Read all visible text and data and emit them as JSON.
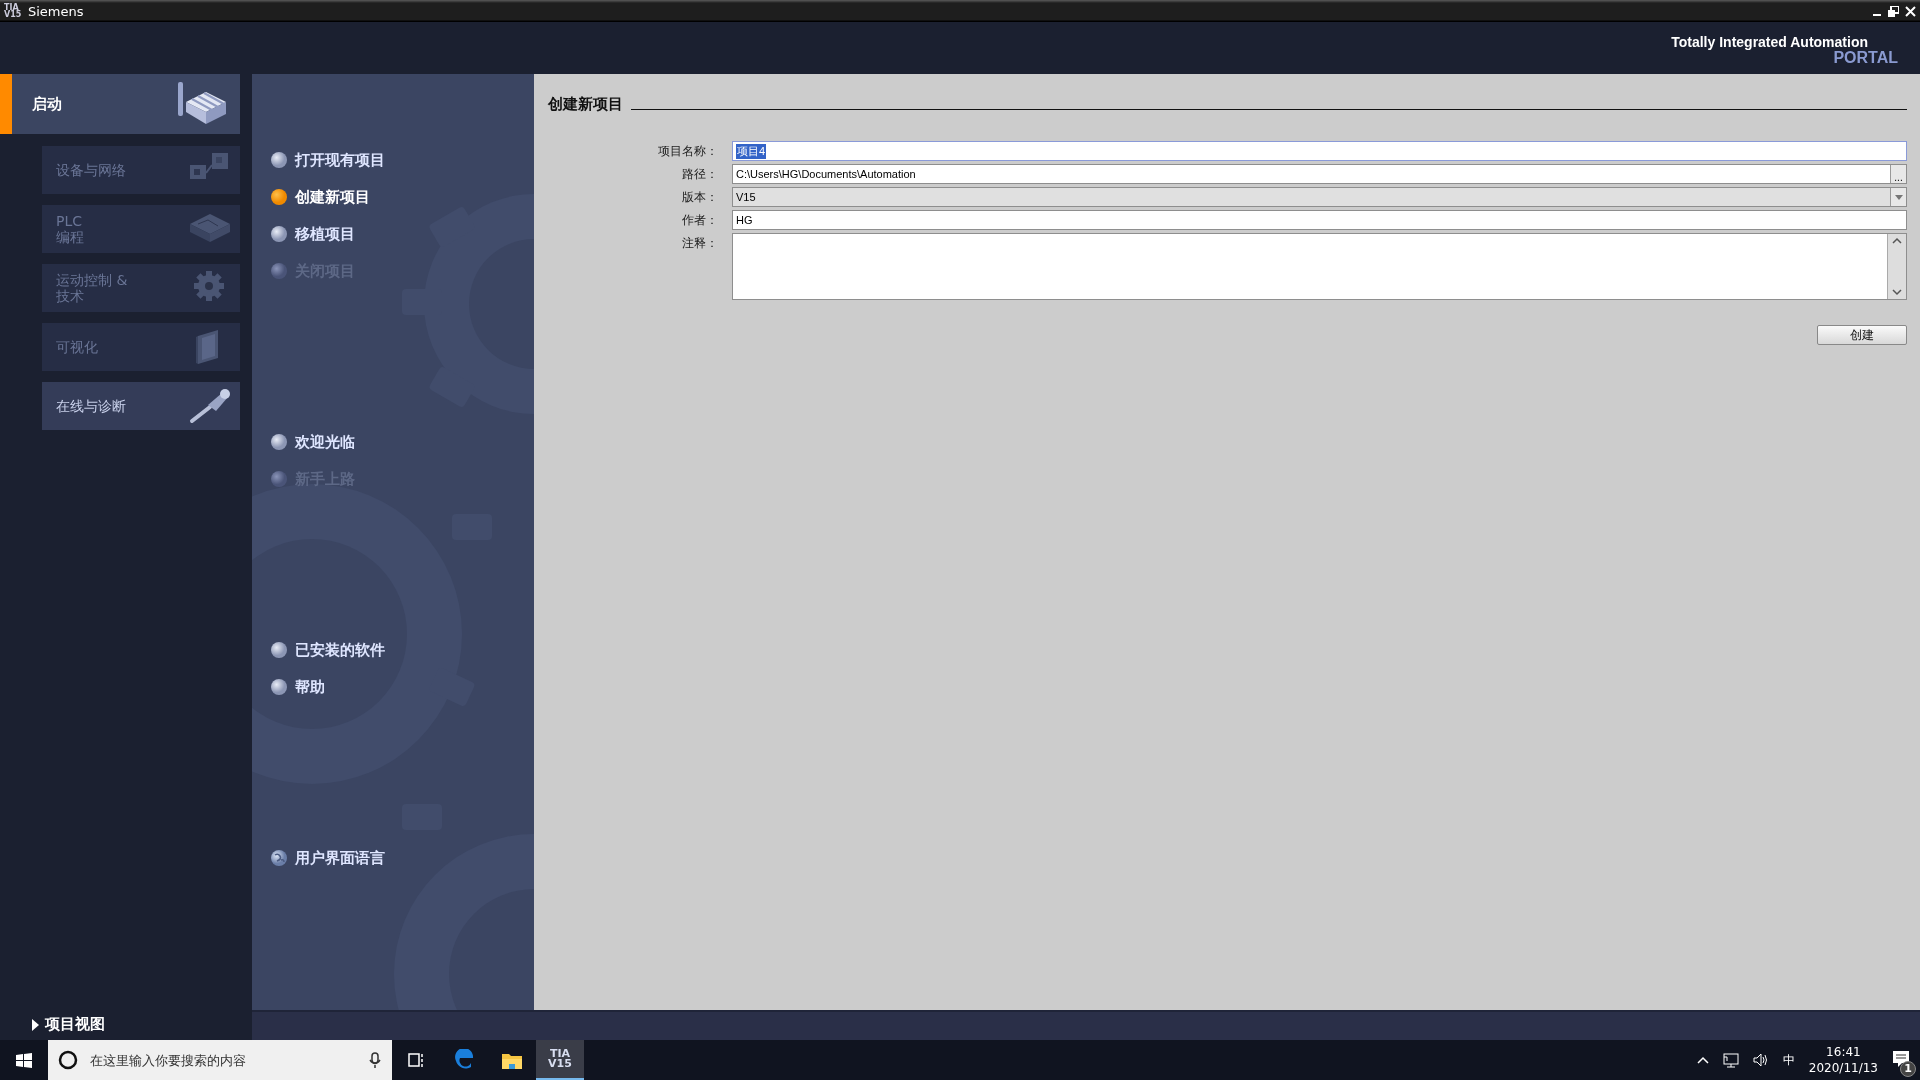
{
  "window": {
    "title": "Siemens",
    "app_icon": [
      "TIA",
      "V15"
    ]
  },
  "header": {
    "product": "Totally Integrated Automation",
    "portal": "PORTAL"
  },
  "sidebar": {
    "start": {
      "label": "启动",
      "selected": true
    },
    "items": [
      {
        "label": "设备与网络",
        "kind": "network",
        "disabled": true
      },
      {
        "label": "PLC\n编程",
        "kind": "plc",
        "disabled": true
      },
      {
        "label": "运动控制 &\n技术",
        "kind": "gear",
        "disabled": true
      },
      {
        "label": "可视化",
        "kind": "screen",
        "disabled": true
      },
      {
        "label": "在线与诊断",
        "kind": "probe",
        "disabled": false
      }
    ],
    "project_view": "项目视图"
  },
  "menu": {
    "groups": [
      [
        {
          "label": "打开现有项目",
          "kind": "bullet",
          "selected": false,
          "disabled": false
        },
        {
          "label": "创建新项目",
          "kind": "bullet",
          "selected": true,
          "disabled": false
        },
        {
          "label": "移植项目",
          "kind": "bullet",
          "selected": false,
          "disabled": false
        },
        {
          "label": "关闭项目",
          "kind": "bullet",
          "selected": false,
          "disabled": true
        }
      ],
      [
        {
          "label": "欢迎光临",
          "kind": "bullet",
          "selected": false,
          "disabled": false
        },
        {
          "label": "新手上路",
          "kind": "bullet",
          "selected": false,
          "disabled": true
        }
      ],
      [
        {
          "label": "已安装的软件",
          "kind": "bullet",
          "selected": false,
          "disabled": false
        },
        {
          "label": "帮助",
          "kind": "bullet",
          "selected": false,
          "disabled": false
        }
      ],
      [
        {
          "label": "用户界面语言",
          "kind": "globe",
          "selected": false,
          "disabled": false
        }
      ]
    ]
  },
  "form": {
    "title": "创建新项目",
    "fields": [
      {
        "label": "项目名称：",
        "kind": "text",
        "value": "项目4",
        "highlighted": true
      },
      {
        "label": "路径：",
        "kind": "browse",
        "value": "C:\\Users\\HG\\Documents\\Automation",
        "highlighted": false,
        "button": "..."
      },
      {
        "label": "版本：",
        "kind": "dropdown",
        "value": "V15",
        "highlighted": false
      },
      {
        "label": "作者：",
        "kind": "text",
        "value": "HG",
        "highlighted": false
      },
      {
        "label": "注释：",
        "kind": "textarea",
        "highlighted": false
      }
    ],
    "create_button": "创建"
  },
  "taskbar": {
    "search_placeholder": "在这里输入你要搜索的内容",
    "apps": [
      {
        "kind": "taskview",
        "selected": false
      },
      {
        "kind": "edge",
        "selected": false
      },
      {
        "kind": "explorer",
        "selected": false
      },
      {
        "kind": "tia",
        "label": [
          "TIA",
          "V15"
        ],
        "selected": true
      }
    ],
    "ime": "中",
    "time": "16:41",
    "date": "2020/11/13",
    "notifications": "1"
  }
}
